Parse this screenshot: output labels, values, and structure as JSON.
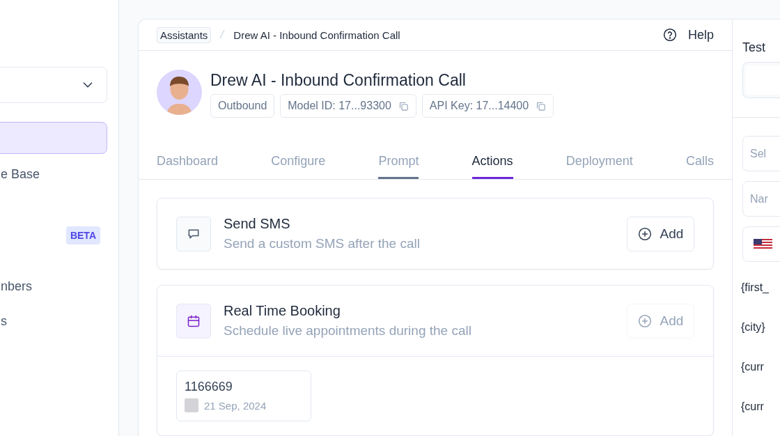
{
  "sidebar": {
    "items": [
      {
        "selected": true
      },
      {
        "label": "e Base",
        "selected": false
      },
      {
        "badge": "BETA",
        "selected": false
      },
      {
        "label": "nbers",
        "selected": false
      },
      {
        "label": "s",
        "selected": false
      }
    ]
  },
  "breadcrumb": [
    {
      "label": "Assistants",
      "kind": "link"
    },
    {
      "label": "Drew AI - Inbound Confirmation Call",
      "kind": "current"
    }
  ],
  "help": "Help",
  "assistant": {
    "name": "Drew AI - Inbound Confirmation Call",
    "tags": [
      {
        "label": "Outbound",
        "copy": false
      },
      {
        "label": "Model ID: 17...93300",
        "copy": true
      },
      {
        "label": "API Key: 17...14400",
        "copy": true
      }
    ]
  },
  "tabs": [
    {
      "label": "Dashboard",
      "selected": false,
      "hovered": false
    },
    {
      "label": "Configure",
      "selected": false,
      "hovered": false
    },
    {
      "label": "Prompt",
      "selected": false,
      "hovered": true
    },
    {
      "label": "Actions",
      "selected": true,
      "hovered": false
    },
    {
      "label": "Deployment",
      "selected": false,
      "hovered": false
    },
    {
      "label": "Calls",
      "selected": false,
      "hovered": false
    }
  ],
  "actions": [
    {
      "kind": "sms",
      "title": "Send SMS",
      "description": "Send a custom SMS after the call",
      "button": "Add",
      "disabled": false
    },
    {
      "kind": "booking",
      "title": "Real Time Booking",
      "description": "Schedule live appointments during the call",
      "button": "Add",
      "disabled": true,
      "bookings": [
        {
          "id": "1166669",
          "date": "21 Sep, 2024"
        }
      ]
    }
  ],
  "test_panel": {
    "title": "Test",
    "fields": [
      {
        "kind": "text",
        "placeholder": "Sel"
      },
      {
        "kind": "text",
        "placeholder": "Nar"
      },
      {
        "kind": "phone"
      }
    ],
    "variables": [
      "{first_",
      "{city}",
      "{curr",
      "{curr"
    ]
  }
}
